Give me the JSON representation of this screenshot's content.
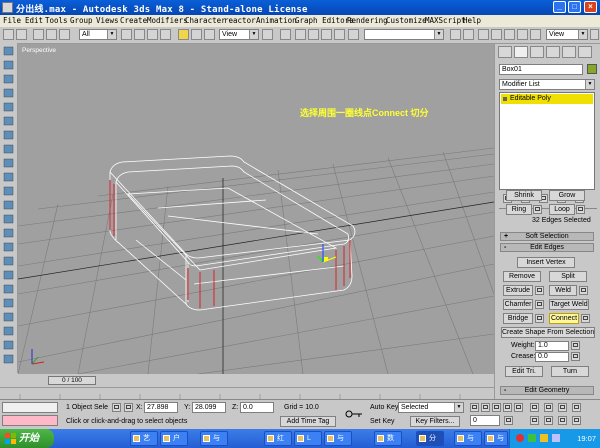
{
  "window": {
    "title": "分出线.max - Autodesk 3ds Max 8  - Stand-alone License"
  },
  "menu": [
    "File",
    "Edit",
    "Tools",
    "Group",
    "Views",
    "Create",
    "Modifiers",
    "Character",
    "reactor",
    "Animation",
    "Graph Editors",
    "Rendering",
    "Customize",
    "MAXScript",
    "Help"
  ],
  "toolbar": {
    "selection_filter": "All",
    "ref_coord": "View",
    "named_selection": "",
    "view_right": "View"
  },
  "viewport": {
    "label": "Perspective",
    "annotation": "选择周围一圈线点Connect 切分"
  },
  "command_panel": {
    "object_name": "Box01",
    "object_color": "#87a72a",
    "modifier_list_label": "Modifier List",
    "stack_item": "Editable Poly",
    "selection": {
      "shrink": "Shrink",
      "grow": "Grow",
      "ring": "Ring",
      "loop": "Loop",
      "status": "32 Edges Selected"
    },
    "soft_selection_title": "Soft Selection",
    "edit_edges": {
      "title": "Edit Edges",
      "insert_vertex": "Insert Vertex",
      "remove": "Remove",
      "split": "Split",
      "extrude": "Extrude",
      "weld": "Weld",
      "chamfer": "Chamfer",
      "target_weld": "Target Weld",
      "bridge": "Bridge",
      "connect": "Connect",
      "create_shape": "Create Shape From Selection",
      "weight_label": "Weight:",
      "weight_value": "1.0",
      "crease_label": "Crease:",
      "crease_value": "0.0",
      "edit_tri": "Edit Tri.",
      "turn": "Turn"
    },
    "edit_geometry_title": "Edit Geometry"
  },
  "timebar": {
    "frame": "0 / 100"
  },
  "status": {
    "selection_count": "1 Object Sele",
    "x_label": "X:",
    "x_value": "27.898",
    "y_label": "Y:",
    "y_value": "28.099",
    "z_label": "Z:",
    "z_value": "0.0",
    "grid": "Grid = 10.0",
    "prompt": "Click or click-and-drag to select objects",
    "add_time_tag": "Add Time Tag",
    "auto_key": "Auto Key",
    "set_key": "Set Key",
    "key_mode": "Selected",
    "key_filters": "Key Filters...",
    "frame_field": "0"
  },
  "taskbar": {
    "start": "开始",
    "tasks": [
      "艺",
      "户",
      "与",
      "红",
      "L",
      "与",
      "数",
      "分",
      "与",
      "与"
    ],
    "clock": "19:07"
  }
}
